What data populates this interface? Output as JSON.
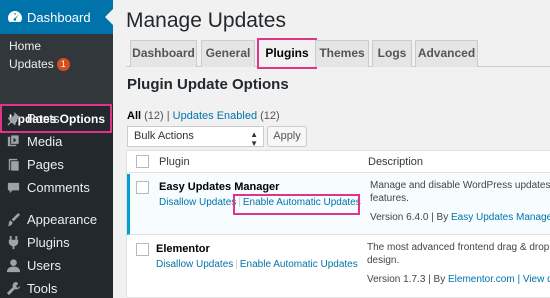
{
  "sidebar": {
    "dashboard_label": "Dashboard",
    "submenu": {
      "home": "Home",
      "updates": "Updates",
      "updates_badge": "1",
      "updates_options": "Updates Options"
    },
    "items": [
      {
        "label": "Posts",
        "icon": "pushpin-icon"
      },
      {
        "label": "Media",
        "icon": "media-icon"
      },
      {
        "label": "Pages",
        "icon": "pages-icon"
      },
      {
        "label": "Comments",
        "icon": "comments-icon"
      },
      {
        "label": "Appearance",
        "icon": "appearance-icon"
      },
      {
        "label": "Plugins",
        "icon": "plugins-icon"
      },
      {
        "label": "Users",
        "icon": "users-icon"
      },
      {
        "label": "Tools",
        "icon": "tools-icon"
      }
    ]
  },
  "main": {
    "title": "Manage Updates",
    "tabs": [
      "Dashboard",
      "General",
      "Plugins",
      "Themes",
      "Logs",
      "Advanced"
    ],
    "active_tab": "Plugins",
    "section_title": "Plugin Update Options",
    "filters": {
      "all": "All",
      "all_count": "(12)",
      "separator": "|",
      "enabled": "Updates Enabled",
      "enabled_count": "(12)"
    },
    "bulk_actions": "Bulk Actions",
    "apply": "Apply",
    "table": {
      "headers": [
        "Plugin",
        "Description"
      ],
      "rows": [
        {
          "name": "Easy Updates Manager",
          "action_disallow": "Disallow Updates",
          "action_enable": "Enable Automatic Updates",
          "desc_line1": "Manage and disable WordPress updates, inc",
          "desc_line2": "features.",
          "version": "Version 6.4.0 | By",
          "author": "Easy Updates Manager T"
        },
        {
          "name": "Elementor",
          "action_disallow": "Disallow Updates",
          "action_enable": "Enable Automatic Updates",
          "desc_line1": "The most advanced frontend drag & drop pa",
          "desc_line2": "design.",
          "version": "Version 1.7.3 | By",
          "author": "Elementor.com",
          "view_details": "| View det"
        }
      ]
    }
  },
  "colors": {
    "sidebar_bg": "#23282d",
    "active_blue": "#0073aa",
    "highlight_pink": "#e0348c",
    "badge_orange": "#d54e21",
    "link_blue": "#0073aa"
  }
}
